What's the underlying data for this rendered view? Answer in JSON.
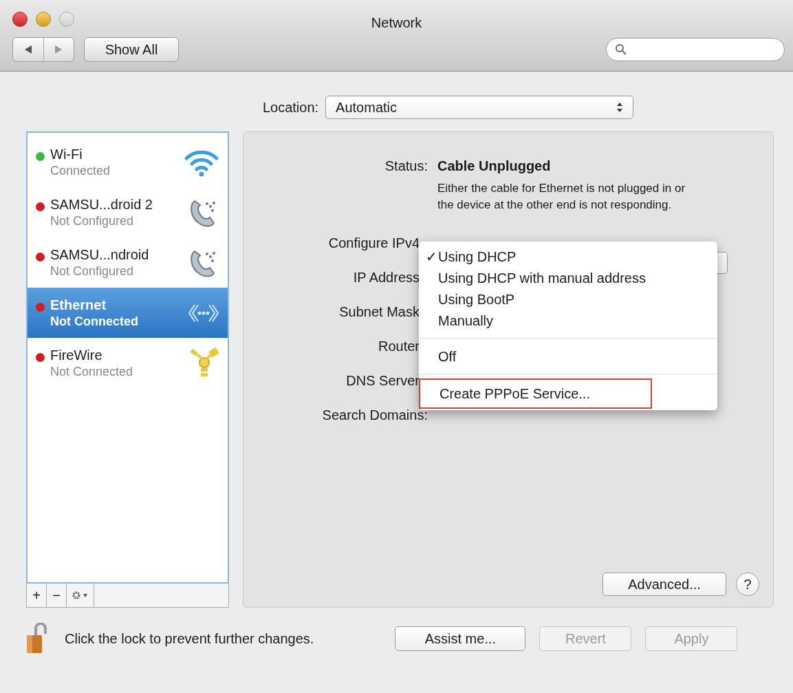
{
  "window": {
    "title": "Network"
  },
  "toolbar": {
    "show_all": "Show All"
  },
  "location": {
    "label": "Location:",
    "value": "Automatic"
  },
  "services": [
    {
      "name": "Wi-Fi",
      "status": "Connected",
      "color": "#3cb83c",
      "kind": "wifi",
      "selected": false
    },
    {
      "name": "SAMSU...droid 2",
      "status": "Not Configured",
      "color": "#d41c1c",
      "kind": "phone",
      "selected": false
    },
    {
      "name": "SAMSU...ndroid",
      "status": "Not Configured",
      "color": "#d41c1c",
      "kind": "phone",
      "selected": false
    },
    {
      "name": "Ethernet",
      "status": "Not Connected",
      "color": "#d41c1c",
      "kind": "ethernet",
      "selected": true
    },
    {
      "name": "FireWire",
      "status": "Not Connected",
      "color": "#d41c1c",
      "kind": "firewire",
      "selected": false
    }
  ],
  "list_buttons": [
    "+",
    "−"
  ],
  "detail": {
    "status_label": "Status:",
    "status_value": "Cable Unplugged",
    "description": "Either the cable for Ethernet is not plugged in or the device at the other end is not responding.",
    "fields": [
      "Configure IPv4",
      "IP Address",
      "Subnet Mask",
      "Router",
      "DNS Server",
      "Search Domains:"
    ],
    "advanced": "Advanced...",
    "help": "?"
  },
  "menu": [
    {
      "kind": "item",
      "label": "Using DHCP",
      "checked": true,
      "outlined": false
    },
    {
      "kind": "item",
      "label": "Using DHCP with manual address",
      "checked": false,
      "outlined": false
    },
    {
      "kind": "item",
      "label": "Using BootP",
      "checked": false,
      "outlined": false
    },
    {
      "kind": "item",
      "label": "Manually",
      "checked": false,
      "outlined": false
    },
    {
      "kind": "separator"
    },
    {
      "kind": "item",
      "label": "Off",
      "checked": false,
      "outlined": false
    },
    {
      "kind": "separator"
    },
    {
      "kind": "item",
      "label": "Create PPPoE Service...",
      "checked": false,
      "outlined": true
    }
  ],
  "check_mark": "✓",
  "lock_text": "Click the lock to prevent further changes.",
  "buttons": [
    {
      "label": "Assist me...",
      "disabled": false
    },
    {
      "label": "Revert",
      "disabled": true
    },
    {
      "label": "Apply",
      "disabled": true
    }
  ]
}
